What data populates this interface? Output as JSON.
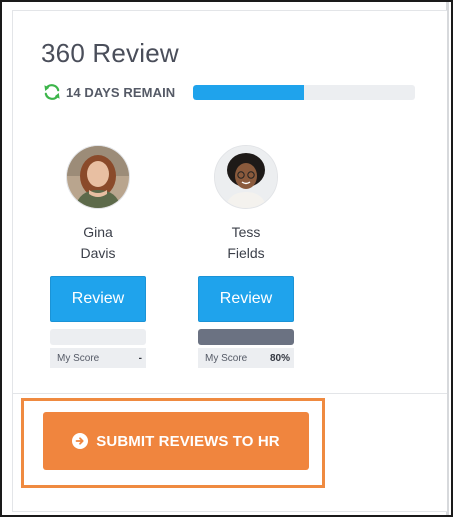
{
  "title": "360 Review",
  "status": {
    "remain_text": "14 DAYS REMAIN",
    "progress_fraction": 0.5,
    "icon": "refresh-icon",
    "icon_color": "#3cb54a",
    "progress_color": "#1fa3ec"
  },
  "reviewees": [
    {
      "first_name": "Gina",
      "last_name": "Davis",
      "button_label": "Review",
      "score_label": "My Score",
      "score_value": "-",
      "score_fraction": 0
    },
    {
      "first_name": "Tess",
      "last_name": "Fields",
      "button_label": "Review",
      "score_label": "My Score",
      "score_value": "80%",
      "score_fraction": 1
    }
  ],
  "submit": {
    "label": "SUBMIT REVIEWS TO HR",
    "icon": "arrow-right-circle-icon",
    "color": "#f0853e",
    "highlight_color": "#ef8a40"
  }
}
